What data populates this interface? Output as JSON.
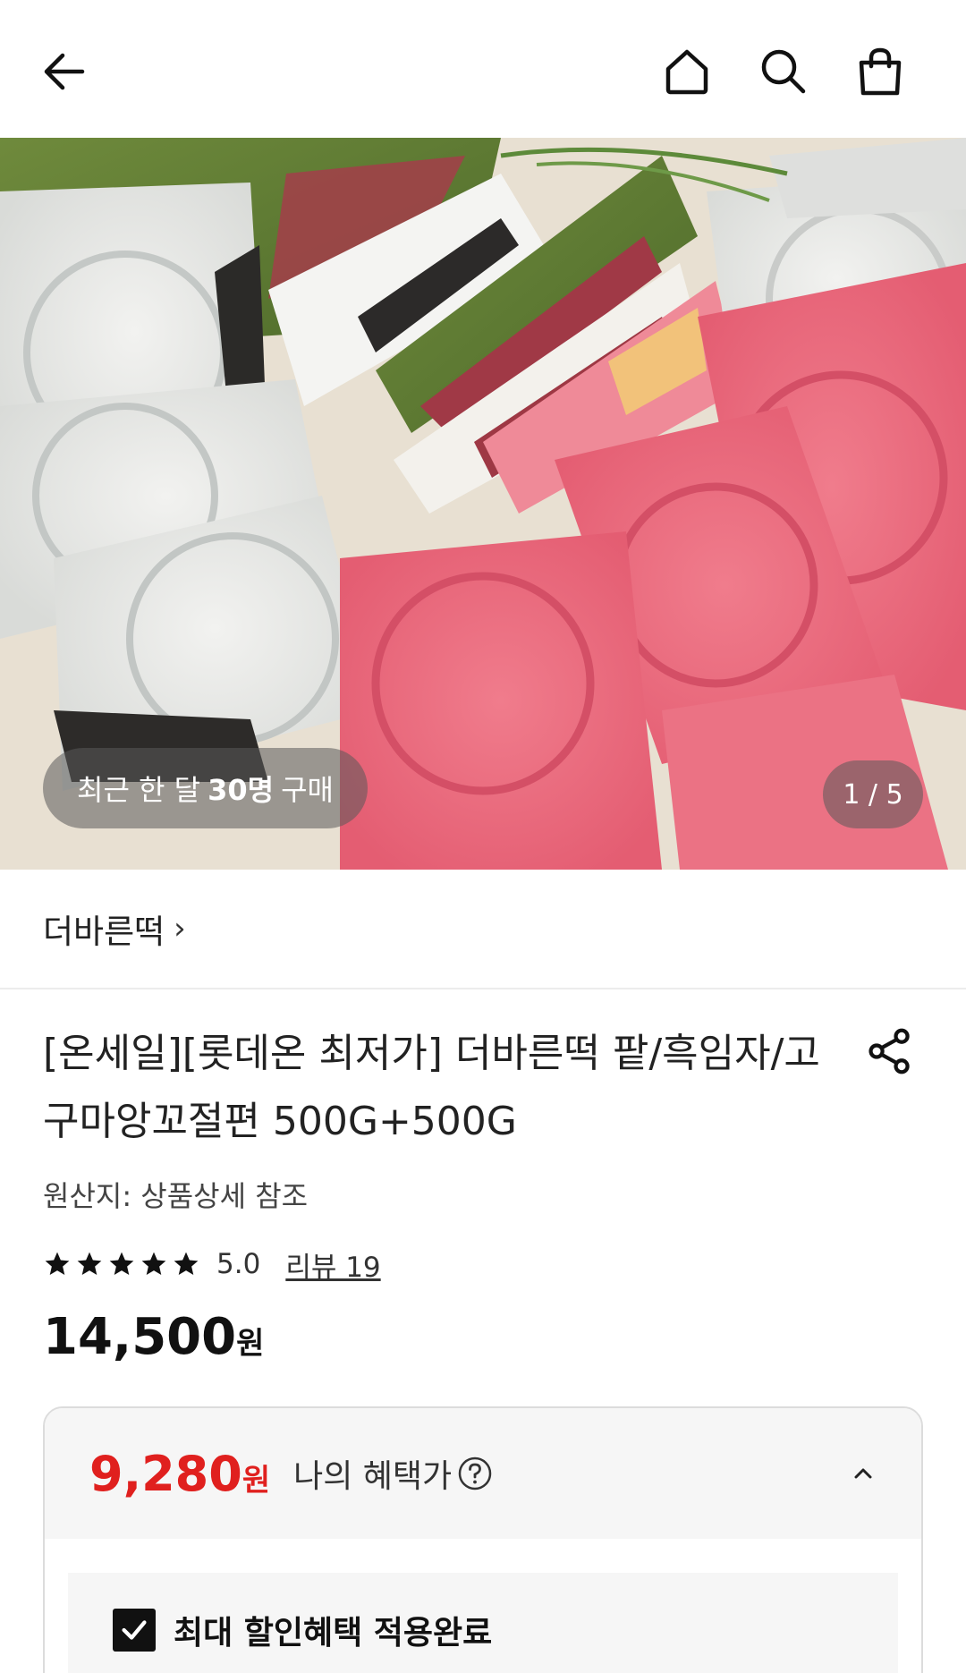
{
  "nav": {
    "back_icon": "arrow-left-icon",
    "home_icon": "home-icon",
    "search_icon": "search-icon",
    "cart_icon": "shopping-bag-icon"
  },
  "hero": {
    "buyers_prefix": "최근 한 달",
    "buyers_count": "30명",
    "buyers_suffix": "구매",
    "pager": "1 / 5"
  },
  "brand": {
    "name": "더바른떡",
    "chevron": "›"
  },
  "product": {
    "title": "[온세일][롯데온 최저가] 더바른떡 팥/흑임자/고구마앙꼬절편 500G+500G",
    "origin": "원산지: 상품상세 참조",
    "rating": "5.0",
    "stars": 5,
    "reviews_label": "리뷰 19",
    "price": "14,500",
    "price_unit": "원"
  },
  "benefit": {
    "sale_price": "9,280",
    "sale_unit": "원",
    "label": "나의 혜택가",
    "checkbox_label": "최대 할인혜택 적용완료",
    "checked": true
  },
  "colors": {
    "sale_red": "#e0201e",
    "text_dark": "#111111",
    "card_bg": "#f6f6f6",
    "border": "#dcdcdc"
  }
}
